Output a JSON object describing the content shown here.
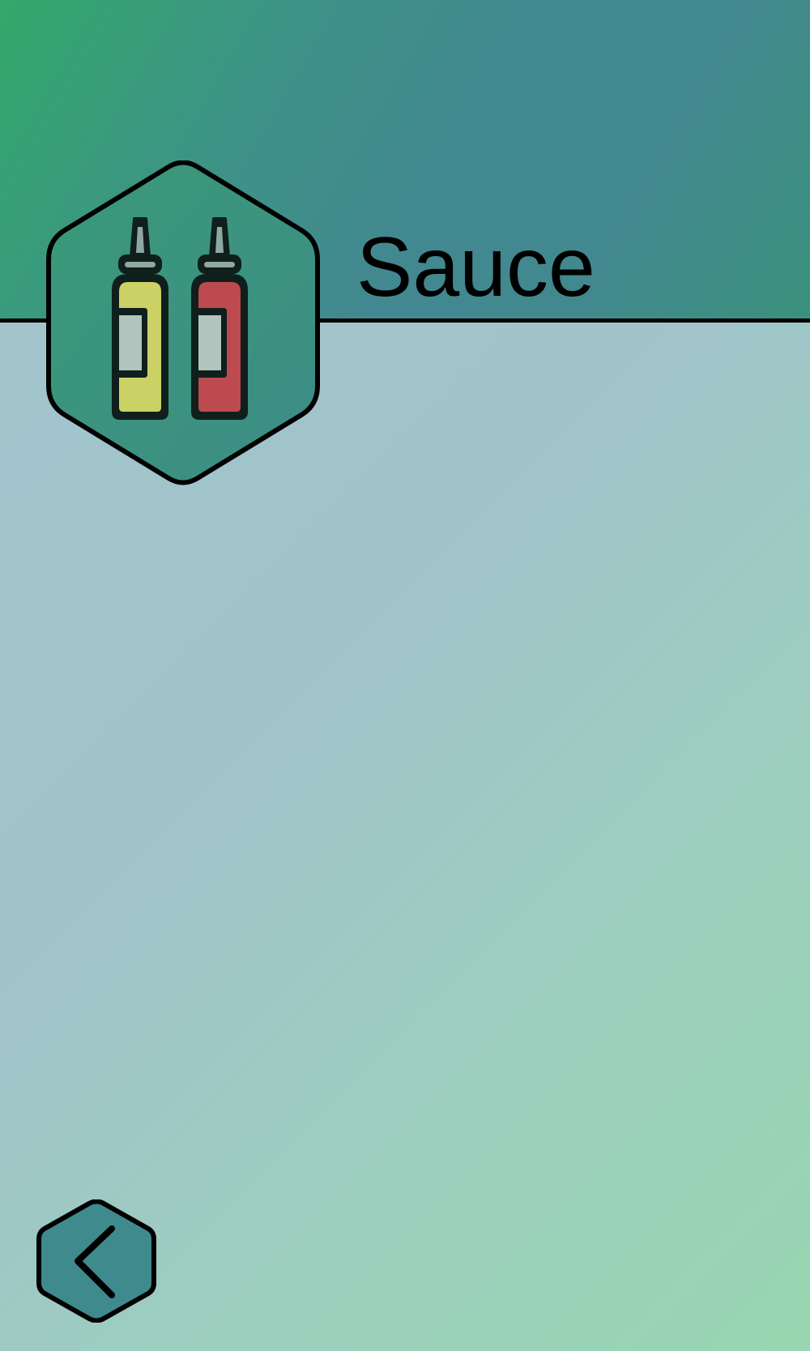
{
  "header": {
    "title": "Sauce",
    "icon": "sauce-bottles-icon"
  },
  "navigation": {
    "back_icon": "chevron-left-icon"
  },
  "colors": {
    "header_gradient_start": "#33a86a",
    "header_gradient_end": "#42888f",
    "body_gradient_start": "#a3c6cd",
    "body_gradient_end": "#97d6b0",
    "badge_fill": "#3a9481",
    "mustard": "#ccd166",
    "ketchup": "#bd4a4f",
    "back_button_fill": "#3f8a8c",
    "outline": "#000000"
  }
}
